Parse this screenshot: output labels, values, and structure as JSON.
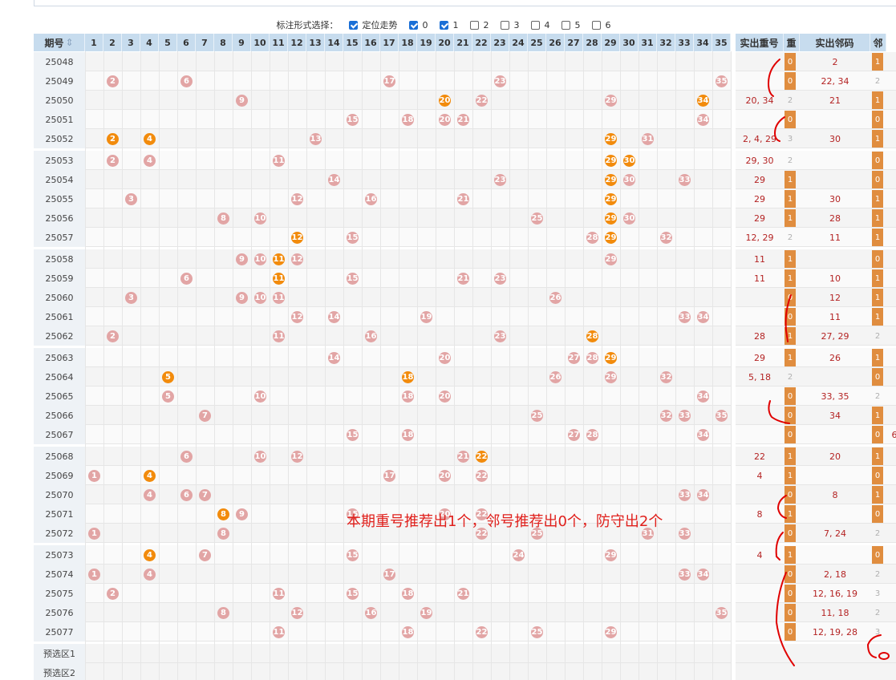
{
  "options": {
    "label": "标注形式选择：",
    "items": [
      {
        "label": "定位走势",
        "checked": true
      },
      {
        "label": "0",
        "checked": true
      },
      {
        "label": "1",
        "checked": true
      },
      {
        "label": "2",
        "checked": false
      },
      {
        "label": "3",
        "checked": false
      },
      {
        "label": "4",
        "checked": false
      },
      {
        "label": "5",
        "checked": false
      },
      {
        "label": "6",
        "checked": false
      }
    ]
  },
  "header": {
    "period": "期号",
    "numbers": [
      "1",
      "2",
      "3",
      "4",
      "5",
      "6",
      "7",
      "8",
      "9",
      "10",
      "11",
      "12",
      "13",
      "14",
      "15",
      "16",
      "17",
      "18",
      "19",
      "20",
      "21",
      "22",
      "23",
      "24",
      "25",
      "26",
      "27",
      "28",
      "29",
      "30",
      "31",
      "32",
      "33",
      "34",
      "35"
    ],
    "repeat_text": "实出重号",
    "repeat_count": "重",
    "neighbor_text": "实出邻码",
    "neighbor_count": "邻"
  },
  "rows": [
    {
      "period": "25048",
      "miss": [],
      "hit": [],
      "repeat": "",
      "rc": "0",
      "neighbor": "2",
      "nc": "1"
    },
    {
      "period": "25049",
      "miss": [
        2,
        6,
        17,
        23,
        35
      ],
      "hit": [],
      "repeat": "",
      "rc": "0",
      "neighbor": "22, 34",
      "nc": "2"
    },
    {
      "period": "25050",
      "miss": [
        9,
        22,
        29
      ],
      "hit": [
        20,
        34
      ],
      "repeat": "20, 34",
      "rc": "2",
      "neighbor": "21",
      "nc": "1"
    },
    {
      "period": "25051",
      "miss": [
        15,
        18,
        20,
        21,
        34
      ],
      "hit": [],
      "repeat": "",
      "rc": "0",
      "neighbor": "",
      "nc": "0"
    },
    {
      "period": "25052",
      "miss": [
        13,
        31
      ],
      "hit": [
        2,
        4,
        29
      ],
      "repeat": "2, 4, 29",
      "rc": "3",
      "neighbor": "30",
      "nc": "1"
    },
    {
      "period": "25053",
      "miss": [
        2,
        4,
        11
      ],
      "hit": [
        29,
        30
      ],
      "repeat": "29, 30",
      "rc": "2",
      "neighbor": "",
      "nc": "0"
    },
    {
      "period": "25054",
      "miss": [
        14,
        23,
        30,
        33
      ],
      "hit": [
        29
      ],
      "repeat": "29",
      "rc": "1",
      "neighbor": "",
      "nc": "0"
    },
    {
      "period": "25055",
      "miss": [
        3,
        12,
        16,
        21
      ],
      "hit": [
        29
      ],
      "repeat": "29",
      "rc": "1",
      "neighbor": "30",
      "nc": "1"
    },
    {
      "period": "25056",
      "miss": [
        8,
        10,
        25,
        30
      ],
      "hit": [
        29
      ],
      "repeat": "29",
      "rc": "1",
      "neighbor": "28",
      "nc": "1"
    },
    {
      "period": "25057",
      "miss": [
        15,
        28,
        32
      ],
      "hit": [
        12,
        29
      ],
      "repeat": "12, 29",
      "rc": "2",
      "neighbor": "11",
      "nc": "1"
    },
    {
      "period": "25058",
      "miss": [
        9,
        10,
        12,
        29
      ],
      "hit": [
        11
      ],
      "repeat": "11",
      "rc": "1",
      "neighbor": "",
      "nc": "0"
    },
    {
      "period": "25059",
      "miss": [
        6,
        15,
        21,
        23
      ],
      "hit": [
        11
      ],
      "repeat": "11",
      "rc": "1",
      "neighbor": "10",
      "nc": "1"
    },
    {
      "period": "25060",
      "miss": [
        3,
        9,
        10,
        11,
        26
      ],
      "hit": [],
      "repeat": "",
      "rc": "0",
      "neighbor": "12",
      "nc": "1"
    },
    {
      "period": "25061",
      "miss": [
        12,
        14,
        19,
        33,
        34
      ],
      "hit": [],
      "repeat": "",
      "rc": "0",
      "neighbor": "11",
      "nc": "1"
    },
    {
      "period": "25062",
      "miss": [
        2,
        11,
        16,
        23
      ],
      "hit": [
        28
      ],
      "repeat": "28",
      "rc": "1",
      "neighbor": "27, 29",
      "nc": "2"
    },
    {
      "period": "25063",
      "miss": [
        14,
        20,
        27,
        28
      ],
      "hit": [
        29
      ],
      "repeat": "29",
      "rc": "1",
      "neighbor": "26",
      "nc": "1"
    },
    {
      "period": "25064",
      "miss": [
        26,
        29,
        32
      ],
      "hit": [
        5,
        18
      ],
      "repeat": "5, 18",
      "rc": "2",
      "neighbor": "",
      "nc": "0"
    },
    {
      "period": "25065",
      "miss": [
        5,
        10,
        18,
        20,
        34
      ],
      "hit": [],
      "repeat": "",
      "rc": "0",
      "neighbor": "33, 35",
      "nc": "2"
    },
    {
      "period": "25066",
      "miss": [
        7,
        25,
        32,
        33,
        35
      ],
      "hit": [],
      "repeat": "",
      "rc": "0",
      "neighbor": "34",
      "nc": "1"
    },
    {
      "period": "25067",
      "miss": [
        15,
        18,
        27,
        28,
        34
      ],
      "hit": [],
      "repeat": "",
      "rc": "0",
      "neighbor": "",
      "nc": "0"
    },
    {
      "period": "25068",
      "miss": [
        6,
        10,
        12,
        21
      ],
      "hit": [
        22
      ],
      "repeat": "22",
      "rc": "1",
      "neighbor": "20",
      "nc": "1"
    },
    {
      "period": "25069",
      "miss": [
        1,
        17,
        20,
        22
      ],
      "hit": [
        4
      ],
      "repeat": "4",
      "rc": "1",
      "neighbor": "",
      "nc": "0"
    },
    {
      "period": "25070",
      "miss": [
        4,
        6,
        7,
        33,
        34
      ],
      "hit": [],
      "repeat": "",
      "rc": "0",
      "neighbor": "8",
      "nc": "1"
    },
    {
      "period": "25071",
      "miss": [
        9,
        15,
        20,
        22
      ],
      "hit": [
        8
      ],
      "repeat": "8",
      "rc": "1",
      "neighbor": "",
      "nc": "0"
    },
    {
      "period": "25072",
      "miss": [
        1,
        8,
        22,
        25,
        31,
        33
      ],
      "hit": [],
      "repeat": "",
      "rc": "0",
      "neighbor": "7, 24",
      "nc": "2"
    },
    {
      "period": "25073",
      "miss": [
        7,
        15,
        24,
        29
      ],
      "hit": [
        4
      ],
      "repeat": "4",
      "rc": "1",
      "neighbor": "",
      "nc": "0"
    },
    {
      "period": "25074",
      "miss": [
        1,
        4,
        17,
        33,
        34
      ],
      "hit": [],
      "repeat": "",
      "rc": "0",
      "neighbor": "2, 18",
      "nc": "2"
    },
    {
      "period": "25075",
      "miss": [
        2,
        11,
        15,
        18,
        21
      ],
      "hit": [],
      "repeat": "",
      "rc": "0",
      "neighbor": "12, 16, 19",
      "nc": "3"
    },
    {
      "period": "25076",
      "miss": [
        8,
        12,
        16,
        19,
        35
      ],
      "hit": [],
      "repeat": "",
      "rc": "0",
      "neighbor": "11, 18",
      "nc": "2"
    },
    {
      "period": "25077",
      "miss": [
        11,
        18,
        22,
        25,
        29
      ],
      "hit": [],
      "repeat": "",
      "rc": "0",
      "neighbor": "12, 19, 28",
      "nc": "3"
    }
  ],
  "preselect": [
    "预选区1",
    "预选区2"
  ],
  "overflow_digit": "6",
  "annotation": "本期重号推荐出1个，邻号推荐出0个，防守出2个",
  "colors": {
    "header_bg": "#c7dcee",
    "miss_ball": "#e2a5a5",
    "hit_ball": "#f28b0c",
    "indicator": "#e08d3f",
    "annotation": "#e0201c",
    "value_text": "#b42323"
  }
}
